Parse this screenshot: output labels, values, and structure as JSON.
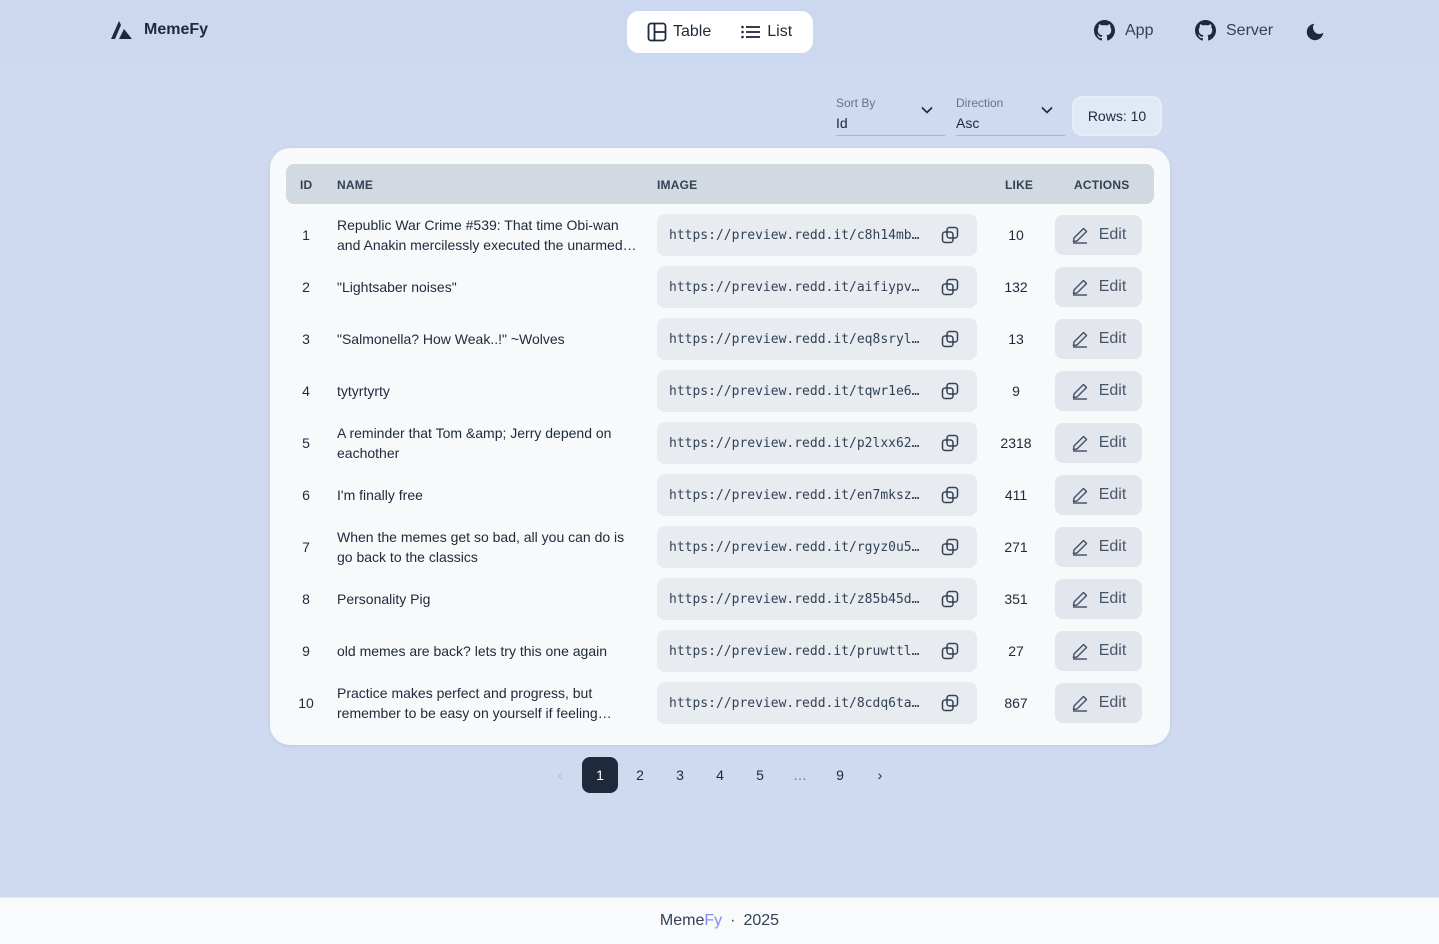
{
  "brand": {
    "name": "MemeFy"
  },
  "view_switch": {
    "table": "Table",
    "list": "List",
    "active": "table"
  },
  "nav": {
    "app": "App",
    "server": "Server"
  },
  "controls": {
    "sort_by": {
      "label": "Sort By",
      "value": "Id"
    },
    "direction": {
      "label": "Direction",
      "value": "Asc"
    },
    "rows_label": "Rows: 10"
  },
  "table": {
    "headers": {
      "id": "ID",
      "name": "NAME",
      "image": "IMAGE",
      "like": "LIKE",
      "actions": "ACTIONS"
    },
    "edit_label": "Edit",
    "rows": [
      {
        "id": "1",
        "name": "Republic War Crime #539: That time Obi-wan and Anakin mercilessly executed the unarmed…",
        "image": "https://preview.redd.it/c8h14mb4…",
        "like": "10"
      },
      {
        "id": "2",
        "name": "\"Lightsaber noises\"",
        "image": "https://preview.redd.it/aifiypvf…",
        "like": "132"
      },
      {
        "id": "3",
        "name": "\"Salmonella? How Weak..!\" ~Wolves",
        "image": "https://preview.redd.it/eq8srylj…",
        "like": "13"
      },
      {
        "id": "4",
        "name": "tytyrtyrty",
        "image": "https://preview.redd.it/tqwr1e63…",
        "like": "9"
      },
      {
        "id": "5",
        "name": "A reminder that Tom &amp; Jerry depend on eachother",
        "image": "https://preview.redd.it/p2lxx62d…",
        "like": "2318"
      },
      {
        "id": "6",
        "name": "I'm finally free",
        "image": "https://preview.redd.it/en7mkszg…",
        "like": "411"
      },
      {
        "id": "7",
        "name": "When the memes get so bad, all you can do is go back to the classics",
        "image": "https://preview.redd.it/rgyz0u5j…",
        "like": "271"
      },
      {
        "id": "8",
        "name": "Personality Pig",
        "image": "https://preview.redd.it/z85b45di…",
        "like": "351"
      },
      {
        "id": "9",
        "name": "old memes are back? lets try this one again",
        "image": "https://preview.redd.it/pruwttlu…",
        "like": "27"
      },
      {
        "id": "10",
        "name": "Practice makes perfect and progress, but remember to be easy on yourself if feeling…",
        "image": "https://preview.redd.it/8cdq6tas…",
        "like": "867"
      }
    ]
  },
  "pagination": {
    "prev": "‹",
    "pages": [
      "1",
      "2",
      "3",
      "4",
      "5",
      "…",
      "9"
    ],
    "current": "1",
    "next": "›"
  },
  "footer": {
    "name_part1": "Meme",
    "name_part2": "Fy",
    "separator": "·",
    "year": "2025"
  },
  "colors": {
    "accent": "#818cf8",
    "primary": "#1e293b",
    "background": "#cfd9f0"
  },
  "icons": {
    "brand": "brand-logo-icon",
    "table": "table-layout-icon",
    "list": "list-icon",
    "github": "github-icon",
    "theme": "moon-icon",
    "copy": "copy-icon",
    "edit": "pencil-icon",
    "chevron": "chevron-down-icon"
  }
}
